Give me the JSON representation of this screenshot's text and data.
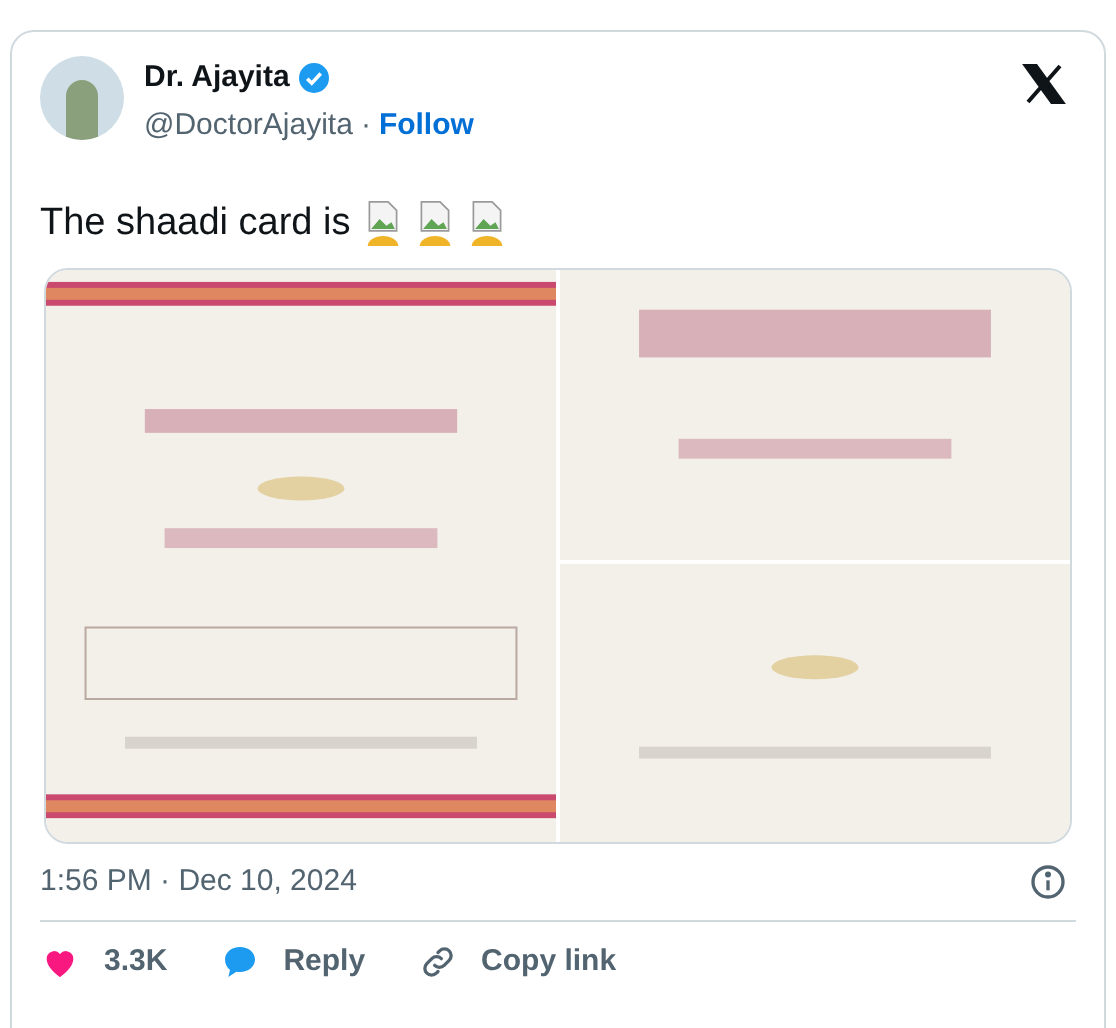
{
  "author": {
    "name": "Dr. Ajayita",
    "verified": true,
    "handle": "@DoctorAjayita",
    "separator": "·",
    "follow": "Follow"
  },
  "text": "The shaadi card is",
  "inline_images": [
    {
      "kind": "broken-image"
    },
    {
      "kind": "broken-image"
    },
    {
      "kind": "broken-image"
    }
  ],
  "timestamp": "1:56 PM · Dec 10, 2024",
  "actions": [
    {
      "kind": "like",
      "label": "3.3K"
    },
    {
      "kind": "reply",
      "label": "Reply"
    },
    {
      "kind": "copy",
      "label": "Copy link"
    }
  ]
}
